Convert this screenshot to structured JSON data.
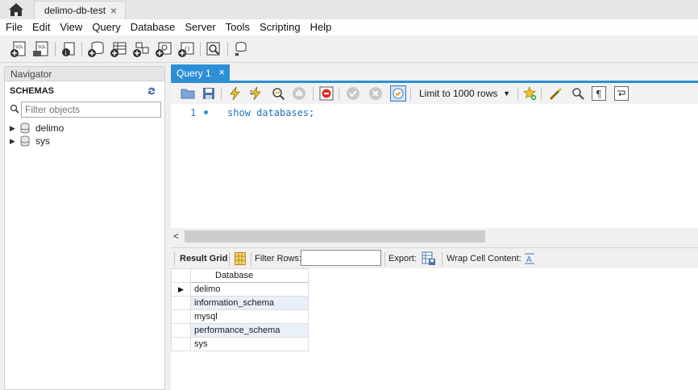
{
  "connection_tab": {
    "title": "delimo-db-test",
    "close": "×"
  },
  "menu": [
    "File",
    "Edit",
    "View",
    "Query",
    "Database",
    "Server",
    "Tools",
    "Scripting",
    "Help"
  ],
  "navigator": {
    "header": "Navigator",
    "schemas_title": "SCHEMAS",
    "filter_placeholder": "Filter objects",
    "schemas": [
      "delimo",
      "sys"
    ]
  },
  "query_tab": {
    "title": "Query 1",
    "close": "×"
  },
  "query_toolbar": {
    "limit_label": "Limit to 1000 rows"
  },
  "editor": {
    "line_number": "1",
    "sql": "show databases;"
  },
  "scrollbar": {
    "left_arrow": "<"
  },
  "result_toolbar": {
    "result_grid_label": "Result Grid",
    "filter_rows_label": "Filter Rows:",
    "export_label": "Export:",
    "wrap_label": "Wrap Cell Content:"
  },
  "result_grid": {
    "column": "Database",
    "rows": [
      "delimo",
      "information_schema",
      "mysql",
      "performance_schema",
      "sys"
    ]
  },
  "colors": {
    "accent": "#2d8fd6",
    "sql_text": "#2372b8",
    "row_alt": "#e9f0f9"
  }
}
